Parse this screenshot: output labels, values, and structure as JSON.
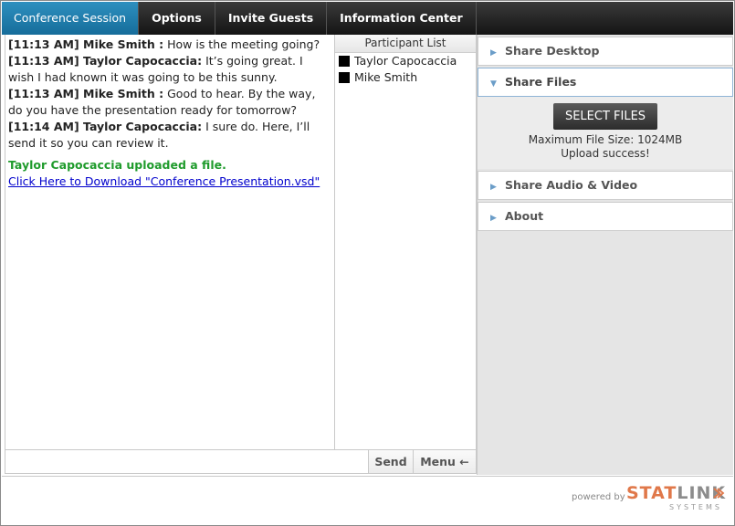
{
  "nav": {
    "tabs": [
      "Conference Session",
      "Options",
      "Invite Guests",
      "Information Center"
    ]
  },
  "chat": {
    "messages": [
      {
        "time": "[11:13 AM]",
        "author": "Mike Smith :",
        "text": "How is the meeting going?"
      },
      {
        "time": "[11:13 AM]",
        "author": "Taylor Capocaccia:",
        "text": "It’s going great. I wish I had known it was going to be this sunny."
      },
      {
        "time": "[11:13 AM]",
        "author": "Mike Smith :",
        "text": "Good to hear. By the way, do you have the presentation ready for tomorrow?"
      },
      {
        "time": "[11:14 AM]",
        "author": "Taylor Capocaccia:",
        "text": "I sure do. Here, I’ll send it so you can review it."
      }
    ],
    "system_message": "Taylor Capocaccia uploaded a file.",
    "download_link": "Click Here to Download \"Conference Presentation.vsd\""
  },
  "participants": {
    "title": "Participant List",
    "list": [
      "Taylor Capocaccia",
      "Mike Smith"
    ]
  },
  "sidebar": {
    "share_desktop": "Share Desktop",
    "share_files": "Share Files",
    "select_files": "SELECT FILES",
    "max_size": "Maximum File Size: 1024MB",
    "upload_status": "Upload success!",
    "share_av": "Share Audio & Video",
    "about": "About"
  },
  "input": {
    "send": "Send",
    "menu": "Menu ←"
  },
  "footer": {
    "powered": "powered by",
    "brand_stat": "STAT",
    "brand_link": "LINK",
    "brand_sub": "SYSTEMS"
  },
  "colors": {
    "active_tab": "#1f7fae",
    "system_green": "#1f9b2c",
    "link_blue": "#0000cc",
    "brand_orange": "#e0784a"
  }
}
